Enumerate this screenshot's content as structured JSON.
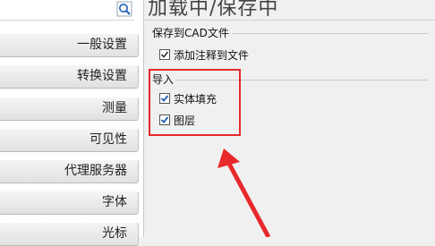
{
  "page_title": "加载中/保存中",
  "sidebar": {
    "items": [
      {
        "label": "一般设置"
      },
      {
        "label": "转换设置"
      },
      {
        "label": "测量"
      },
      {
        "label": "可见性"
      },
      {
        "label": "代理服务器"
      },
      {
        "label": "字体"
      },
      {
        "label": "光标"
      }
    ]
  },
  "save_group": {
    "label": "保存到CAD文件",
    "add_comments": {
      "label": "添加注释到文件",
      "checked": true
    }
  },
  "import_group": {
    "label": "导入",
    "solid_fill": {
      "label": "实体填充",
      "checked": true
    },
    "layers": {
      "label": "图层",
      "checked": true
    }
  },
  "colors": {
    "highlight": "#e8282b",
    "accent_blue": "#1e5fb4"
  },
  "icons": {
    "search": "search-icon",
    "checkmark": "checkmark-icon",
    "arrow": "annotation-arrow-icon"
  }
}
